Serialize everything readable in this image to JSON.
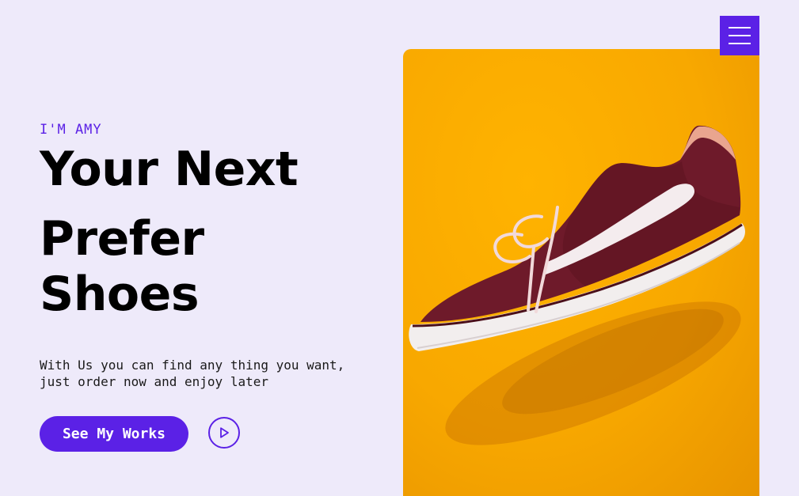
{
  "header": {
    "menu_icon": "hamburger-menu-icon"
  },
  "hero": {
    "eyebrow": "I'M AMY",
    "headline": {
      "line1": "Your Next",
      "line2": "Prefer",
      "line3": "Shoes"
    },
    "description": {
      "line1": "With Us you can find any thing you want,",
      "line2": "just order now and enjoy later"
    },
    "cta_label": "See My Works",
    "play_icon": "play-icon",
    "image": {
      "subject": "sneaker-photo",
      "background_color": "#F8A800",
      "shoe_color": "#6E1A2A"
    }
  },
  "colors": {
    "background": "#EEEAFA",
    "accent": "#5B21E6",
    "text": "#000000"
  }
}
